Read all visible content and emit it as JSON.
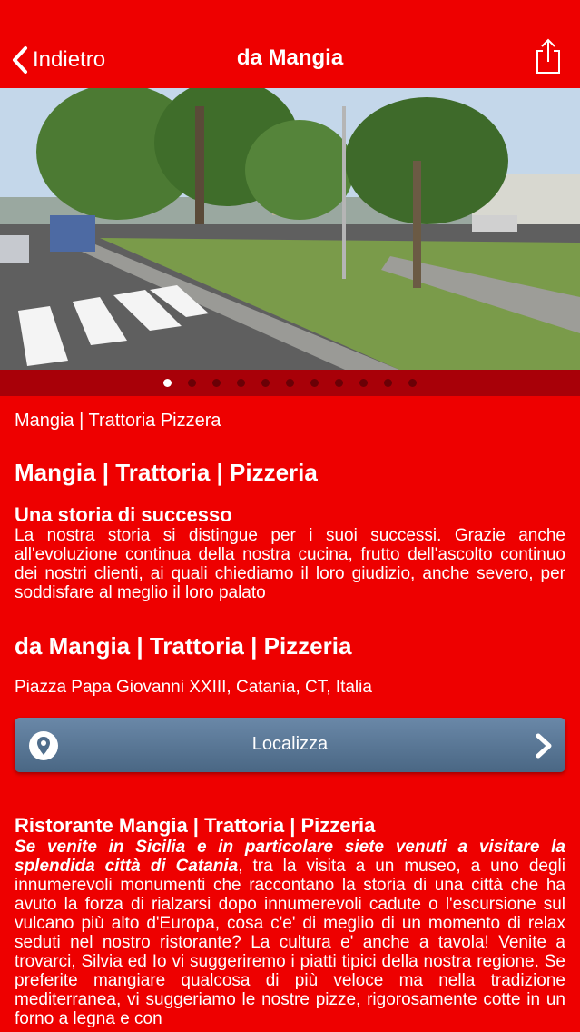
{
  "navbar": {
    "back_label": "Indietro",
    "title": "da Mangia",
    "icons": {
      "back": "chevron-left-icon",
      "share": "share-icon"
    }
  },
  "gallery": {
    "photo_count": 13,
    "active_photo_index": 4,
    "page_count": 11,
    "active_page_index": 0
  },
  "content": {
    "subtitle": "Mangia | Trattoria Pizzera",
    "heading1": "Mangia | Trattoria | Pizzeria",
    "story_title": "Una storia di successo",
    "story_text": "La nostra storia si distingue per i suoi successi. Grazie anche all'evoluzione continua della nostra cucina, frutto dell'ascolto continuo dei nostri clienti, ai quali chiediamo il loro  giudizio, anche severo,  per  soddisfare al meglio  il loro palato",
    "place_name": "da Mangia | Trattoria | Pizzeria",
    "address": "Piazza Papa Giovanni XXIII, Catania, CT, Italia",
    "locate_label": "Localizza",
    "restaurant_title": "Ristorante Mangia | Trattoria | Pizzeria",
    "restaurant_intro_emph": "Se venite in Sicilia e in particolare siete venuti a visitare la splendida città di Catania",
    "restaurant_text": ", tra la visita a un museo, a uno degli innumerevoli monumenti che raccontano la storia di una città che ha avuto la forza di rialzarsi dopo innumerevoli cadute o l'escursione sul vulcano più alto d'Europa, cosa c'e' di meglio di un momento di relax seduti nel nostro ristorante? La cultura e' anche a tavola! Venite a trovarci, Silvia ed Io vi suggeriremo i piatti tipici della nostra regione. Se preferite mangiare qualcosa di più veloce ma nella tradizione mediterranea, vi suggeriamo le nostre pizze, rigorosamente cotte in un forno a legna e con"
  },
  "colors": {
    "background": "#ee0000",
    "strip": "#a80008",
    "button": "#56738f",
    "active_photo_dot": "#f0a020"
  }
}
